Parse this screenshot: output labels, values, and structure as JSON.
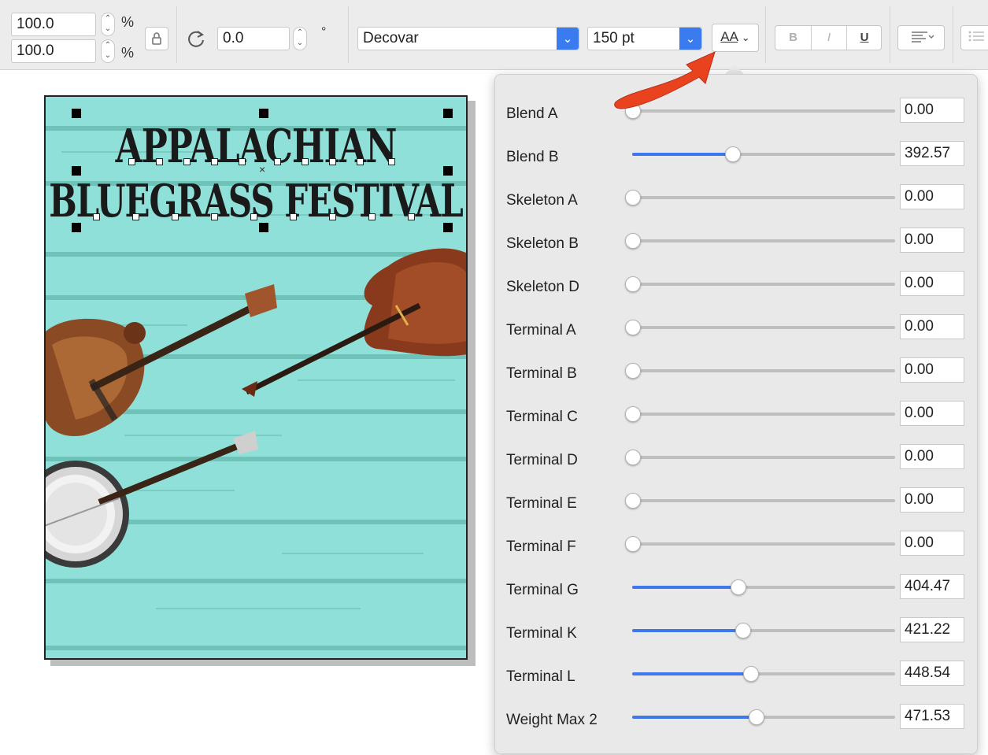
{
  "toolbar": {
    "scale_x": "100.0",
    "scale_y": "100.0",
    "percent_unit": "%",
    "rotation": "0.0",
    "degree_unit": "°",
    "font_name": "Decovar",
    "font_size": "150 pt",
    "variable_font_button": "AA",
    "bold_label": "B",
    "italic_label": "I",
    "underline_label": "U",
    "icons": {
      "lock": "lock-icon",
      "rotate": "rotate-icon",
      "align": "text-align-icon",
      "list": "list-icon"
    }
  },
  "poster": {
    "title_line1": "APPALACHIAN",
    "title_line2": "BLUEGRASS FESTIVAL",
    "background_color": "#8fe0d8",
    "title_color": "#1a1a1a"
  },
  "annotation": {
    "arrow_color": "#e8421f"
  },
  "variable_axes": {
    "accent_color": "#3f78ec",
    "axes": [
      {
        "label": "Blend A",
        "value": "0.00",
        "level": 0
      },
      {
        "label": "Blend B",
        "value": "392.57",
        "level": 0.38
      },
      {
        "label": "Skeleton A",
        "value": "0.00",
        "level": 0
      },
      {
        "label": "Skeleton B",
        "value": "0.00",
        "level": 0
      },
      {
        "label": "Skeleton D",
        "value": "0.00",
        "level": 0
      },
      {
        "label": "Terminal A",
        "value": "0.00",
        "level": 0
      },
      {
        "label": "Terminal B",
        "value": "0.00",
        "level": 0
      },
      {
        "label": "Terminal C",
        "value": "0.00",
        "level": 0
      },
      {
        "label": "Terminal D",
        "value": "0.00",
        "level": 0
      },
      {
        "label": "Terminal E",
        "value": "0.00",
        "level": 0
      },
      {
        "label": "Terminal F",
        "value": "0.00",
        "level": 0
      },
      {
        "label": "Terminal G",
        "value": "404.47",
        "level": 0.4
      },
      {
        "label": "Terminal K",
        "value": "421.22",
        "level": 0.42
      },
      {
        "label": "Terminal L",
        "value": "448.54",
        "level": 0.45
      },
      {
        "label": "Weight Max 2",
        "value": "471.53",
        "level": 0.47
      }
    ]
  }
}
